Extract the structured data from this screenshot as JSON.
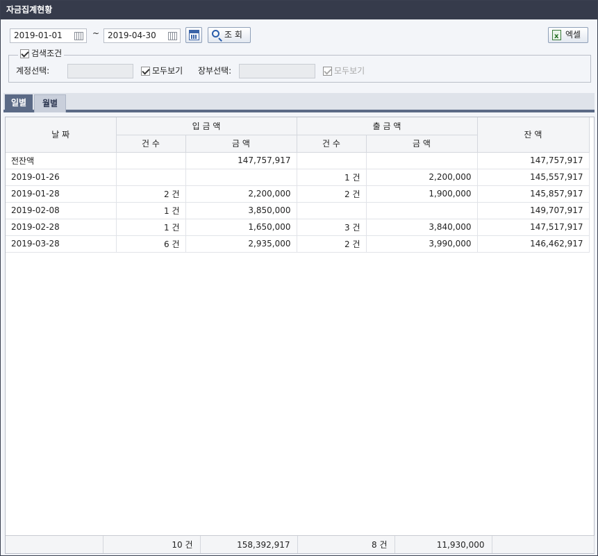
{
  "window": {
    "title": "자금집계현황"
  },
  "search": {
    "from_date": "2019-01-01",
    "tilde": "~",
    "to_date": "2019-04-30",
    "search_label": "조 회",
    "excel_label": "엑셀"
  },
  "conditions": {
    "legend": "검색조건",
    "account_label": "계정선택:",
    "account_value": "",
    "account_all_label": "모두보기",
    "ledger_label": "장부선택:",
    "ledger_value": "",
    "ledger_all_label": "모두보기"
  },
  "tabs": [
    {
      "label": "일별",
      "active": true
    },
    {
      "label": "월별",
      "active": false
    }
  ],
  "grid": {
    "headers": {
      "date": "날 짜",
      "income": "입 금 액",
      "expense": "출 금 액",
      "balance": "잔 액",
      "count": "건 수",
      "amount": "금 액"
    },
    "rows": [
      {
        "date": "전잔액",
        "in_count": "",
        "in_amount": "147,757,917",
        "out_count": "",
        "out_amount": "",
        "balance": "147,757,917"
      },
      {
        "date": "2019-01-26",
        "in_count": "",
        "in_amount": "",
        "out_count": "1 건",
        "out_amount": "2,200,000",
        "balance": "145,557,917"
      },
      {
        "date": "2019-01-28",
        "in_count": "2 건",
        "in_amount": "2,200,000",
        "out_count": "2 건",
        "out_amount": "1,900,000",
        "balance": "145,857,917"
      },
      {
        "date": "2019-02-08",
        "in_count": "1 건",
        "in_amount": "3,850,000",
        "out_count": "",
        "out_amount": "",
        "balance": "149,707,917"
      },
      {
        "date": "2019-02-28",
        "in_count": "1 건",
        "in_amount": "1,650,000",
        "out_count": "3 건",
        "out_amount": "3,840,000",
        "balance": "147,517,917"
      },
      {
        "date": "2019-03-28",
        "in_count": "6 건",
        "in_amount": "2,935,000",
        "out_count": "2 건",
        "out_amount": "3,990,000",
        "balance": "146,462,917"
      }
    ],
    "footer": {
      "in_count": "10 건",
      "in_amount": "158,392,917",
      "out_count": "8 건",
      "out_amount": "11,930,000",
      "balance": ""
    }
  }
}
